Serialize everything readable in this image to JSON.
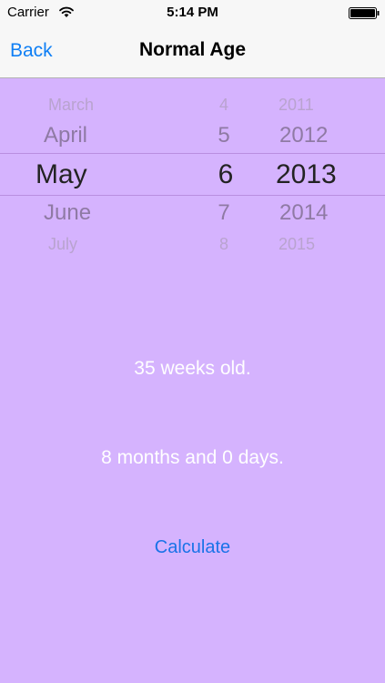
{
  "status_bar": {
    "carrier": "Carrier",
    "time": "5:14 PM",
    "wifi_icon": "wifi-icon",
    "battery_icon": "battery-icon"
  },
  "nav": {
    "back_label": "Back",
    "title": "Normal Age"
  },
  "picker": {
    "months": [
      "March",
      "April",
      "May",
      "June",
      "July"
    ],
    "days": [
      "4",
      "5",
      "6",
      "7",
      "8"
    ],
    "years": [
      "2011",
      "2012",
      "2013",
      "2014",
      "2015"
    ],
    "selected": {
      "month": "May",
      "day": "6",
      "year": "2013"
    }
  },
  "results": {
    "weeks": "35 weeks old.",
    "months": "8 months and 0 days."
  },
  "calculate_label": "Calculate",
  "colors": {
    "background": "#d5b3fe",
    "accent": "#0f7ff5"
  }
}
